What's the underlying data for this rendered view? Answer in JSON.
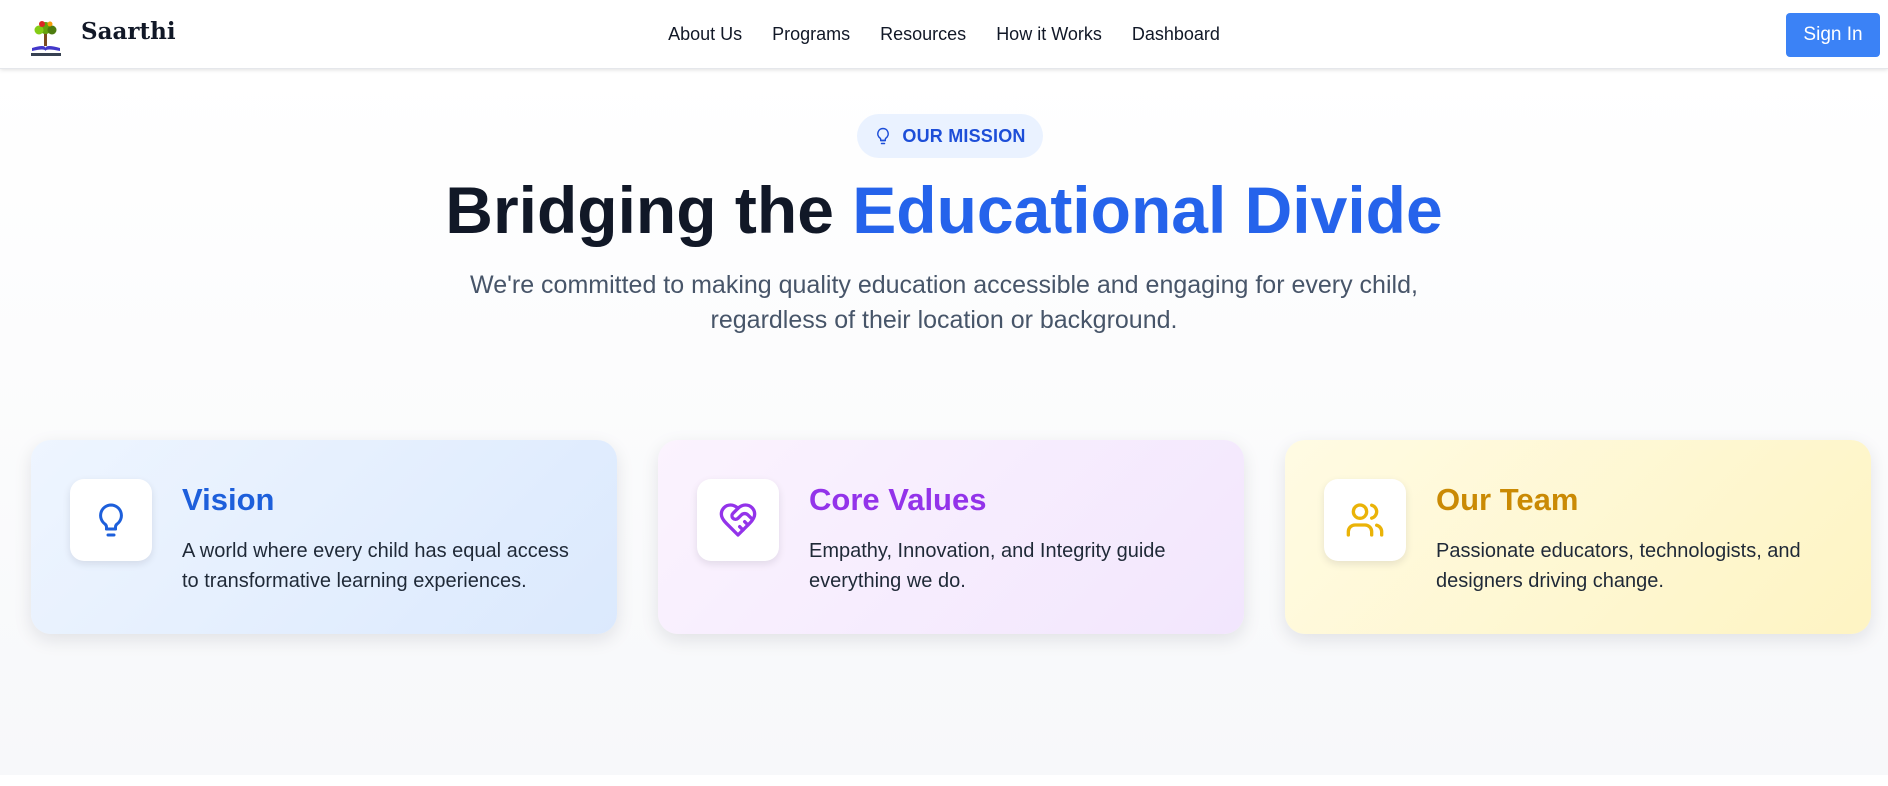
{
  "colors": {
    "accent": "#2563eb",
    "signin_bg": "#3b82f6",
    "vision_title": "#1d5fdb",
    "values_title": "#9333ea",
    "team_title": "#ca8a04"
  },
  "header": {
    "brand": "Saarthi",
    "logo_icon": "tree-book-logo",
    "nav": [
      "About Us",
      "Programs",
      "Resources",
      "How it Works",
      "Dashboard"
    ],
    "signin_label": "Sign In"
  },
  "hero": {
    "badge_icon": "lightbulb-icon",
    "badge": "OUR MISSION",
    "title_main": "Bridging the ",
    "title_accent": "Educational Divide",
    "subtitle": "We're committed to making quality education accessible and engaging for every child, regardless of their location or background."
  },
  "cards": [
    {
      "icon": "lightbulb-icon",
      "title": "Vision",
      "text": "A world where every child has equal access to transformative learning experiences."
    },
    {
      "icon": "heart-handshake-icon",
      "title": "Core Values",
      "text": "Empathy, Innovation, and Integrity guide everything we do."
    },
    {
      "icon": "users-icon",
      "title": "Our Team",
      "text": "Passionate educators, technologists, and designers driving change."
    }
  ]
}
